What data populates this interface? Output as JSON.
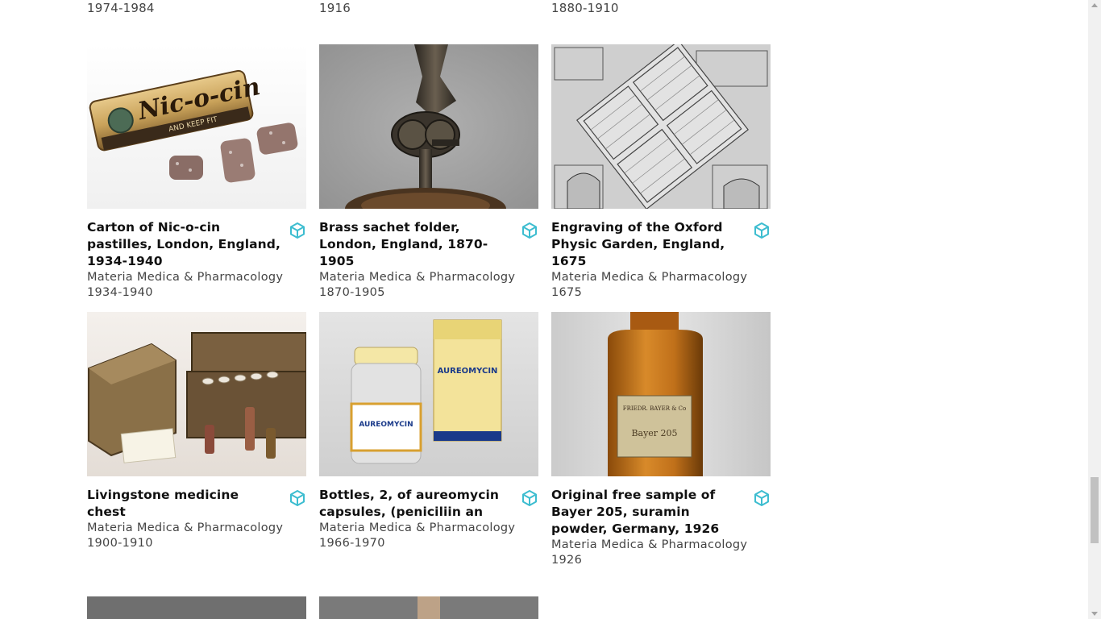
{
  "top_dates": [
    "1974-1984",
    "1916",
    "1880-1910"
  ],
  "cards": [
    {
      "title": "Carton of Nic-o-cin pastilles, London, England, 1934-1940",
      "category": "Materia Medica & Pharmacology",
      "date": "1934-1940",
      "image_label": "EAT Nic-o-cin AND KEEP FIT"
    },
    {
      "title": "Brass sachet folder, London, England, 1870-1905",
      "category": "Materia Medica & Pharmacology",
      "date": "1870-1905"
    },
    {
      "title": "Engraving of the Oxford Physic Garden, England, 1675",
      "category": "Materia Medica & Pharmacology",
      "date": "1675"
    },
    {
      "title": "Livingstone medicine chest",
      "category": "Materia Medica & Pharmacology",
      "date": "1900-1910"
    },
    {
      "title": "Bottles, 2, of aureomycin capsules, (peniciliin an",
      "category": "Materia Medica & Pharmacology",
      "date": "1966-1970",
      "image_label": "AUREOMYCIN"
    },
    {
      "title": "Original free sample of Bayer 205, suramin powder, Germany, 1926",
      "category": "Materia Medica & Pharmacology",
      "date": "1926",
      "image_label": "Bayer 205"
    }
  ],
  "icons": {
    "model": "3d-cube-icon"
  },
  "colors": {
    "accent": "#3dbdd0",
    "text": "#111111",
    "muted": "#444444"
  }
}
